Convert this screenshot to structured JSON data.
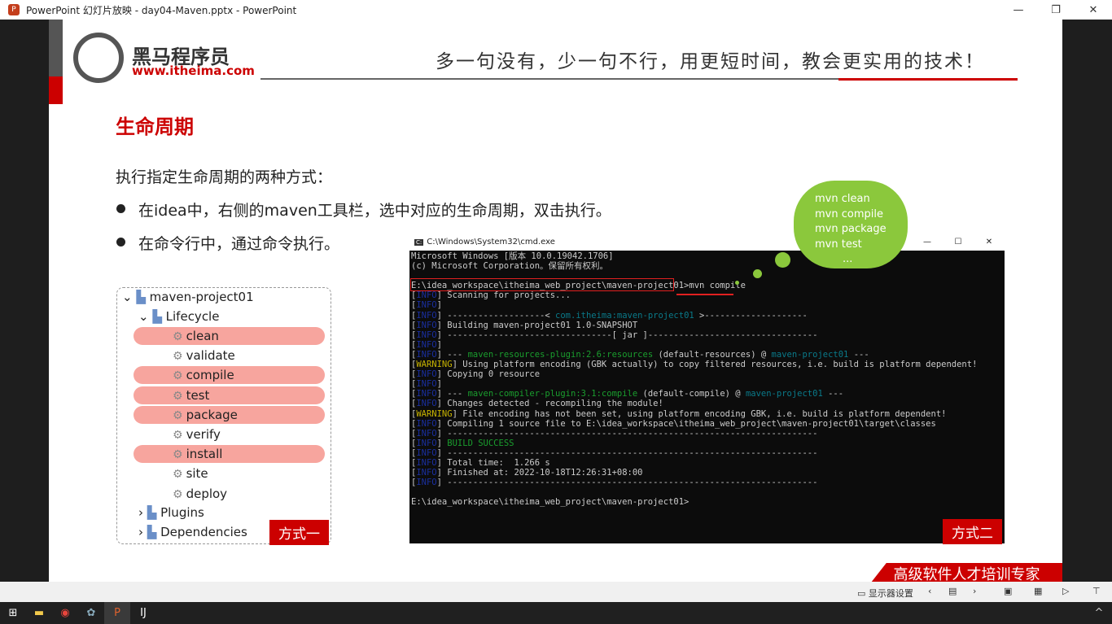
{
  "window": {
    "title": "PowerPoint 幻灯片放映 - day04-Maven.pptx - PowerPoint",
    "minimize": "—",
    "restore": "❐",
    "close": "✕"
  },
  "slide": {
    "logo_name": "黑马程序员",
    "logo_url": "www.itheima.com",
    "tagline": "多一句没有，少一句不行，用更短时间，教会更实用的技术！",
    "heading": "生命周期",
    "intro": "执行指定生命周期的两种方式：",
    "bullets": [
      "在idea中，右侧的maven工具栏，选中对应的生命周期，双击执行。",
      "在命令行中，通过命令执行。"
    ],
    "tree": {
      "project": "maven-project01",
      "lifecycle": "Lifecycle",
      "phases": [
        {
          "label": "clean",
          "highlight": true
        },
        {
          "label": "validate",
          "highlight": false
        },
        {
          "label": "compile",
          "highlight": true
        },
        {
          "label": "test",
          "highlight": true
        },
        {
          "label": "package",
          "highlight": true
        },
        {
          "label": "verify",
          "highlight": false
        },
        {
          "label": "install",
          "highlight": true
        },
        {
          "label": "site",
          "highlight": false
        },
        {
          "label": "deploy",
          "highlight": false
        }
      ],
      "plugins": "Plugins",
      "dependencies": "Dependencies",
      "tag": "方式一"
    },
    "cmd": {
      "title": "C:\\Windows\\System32\\cmd.exe",
      "tag": "方式二",
      "line1": "Microsoft Windows [版本 10.0.19042.1706]",
      "line2": "(c) Microsoft Corporation。保留所有权利。",
      "prompt": "E:\\idea_workspace\\itheima_web_project\\maven-project01",
      "command": "mvn compile",
      "scan": " Scanning for projects...",
      "sep1a": " -------------------< ",
      "coord": "com.itheima:maven-project01",
      "sep1b": " >--------------------",
      "building": " Building maven-project01 1.0-SNAPSHOT",
      "jar": " --------------------------------[ jar ]---------------------------------",
      "res_a": " --- ",
      "res_plugin": "maven-resources-plugin:2.6:resources",
      "res_b": " (default-resources) @ ",
      "res_proj": "maven-project01",
      "res_c": " ---",
      "warn1": " Using platform encoding (GBK actually) to copy filtered resources, i.e. build is platform dependent!",
      "copying": " Copying 0 resource",
      "comp_plugin": "maven-compiler-plugin:3.1:compile",
      "comp_b": " (default-compile) @ ",
      "changes": " Changes detected - recompiling the module!",
      "warn2": " File encoding has not been set, using platform encoding GBK, i.e. build is platform dependent!",
      "compiling": " Compiling 1 source file to E:\\idea_workspace\\itheima_web_project\\maven-project01\\target\\classes",
      "dashes": " ------------------------------------------------------------------------",
      "success": "BUILD SUCCESS",
      "total": " Total time:  1.266 s",
      "finished": " Finished at: 2022-10-18T12:26:31+08:00",
      "final_prompt": "E:\\idea_workspace\\itheima_web_project\\maven-project01>",
      "info": "INFO",
      "warning": "WARNING"
    },
    "cloud": [
      "mvn clean",
      "mvn compile",
      "mvn package",
      "mvn test",
      "..."
    ],
    "banner": "高级软件人才培训专家"
  },
  "controls": {
    "display_settings": "显示器设置"
  },
  "colors": {
    "accent": "#cc0000",
    "highlight": "#f7a59e",
    "cloud": "#8bc83c"
  }
}
